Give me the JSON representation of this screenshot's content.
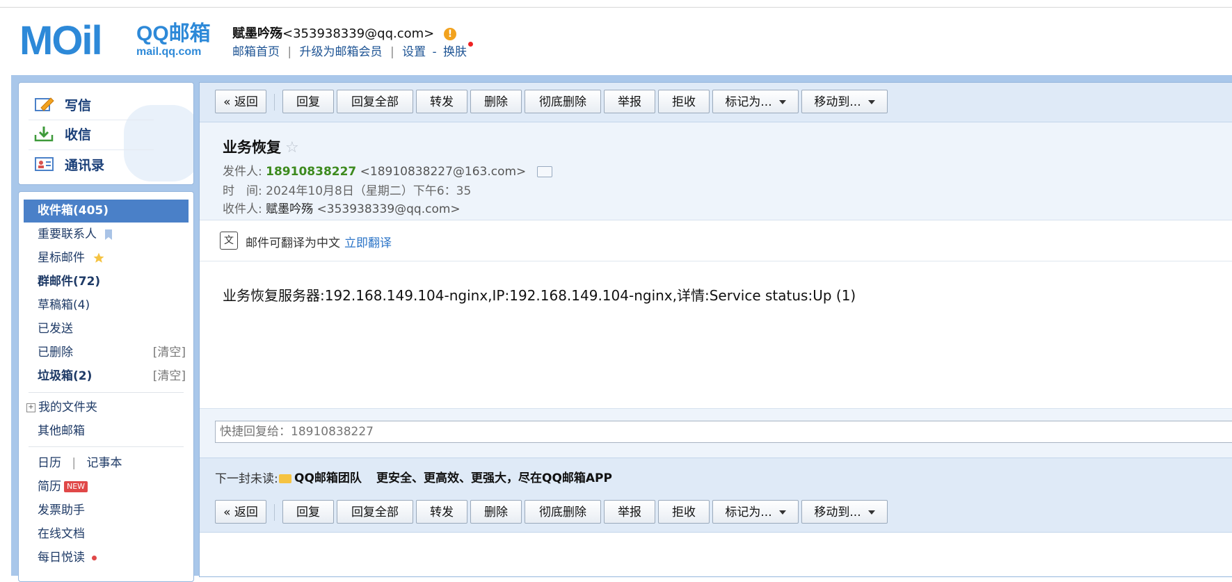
{
  "header": {
    "logo_dom": "mail.qq.com",
    "logo_qq": "QQ邮箱",
    "logo_mark": "MOil",
    "user_name": "赋墨吟殇",
    "user_email": "<353938339@qq.com>",
    "links": [
      "邮箱首页",
      "升级为邮箱会员",
      "设置",
      "换肤"
    ],
    "sep_bar": "|",
    "sep_dash": "-"
  },
  "quick": {
    "compose": "写信",
    "receive": "收信",
    "contacts": "通讯录"
  },
  "folders": {
    "inbox": "收件箱(405)",
    "vip": "重要联系人",
    "starred": "星标邮件",
    "groups": "群邮件(72)",
    "drafts": "草稿箱(4)",
    "sent": "已发送",
    "deleted": "已删除",
    "junk": "垃圾箱(2)",
    "clear": "[清空]",
    "my_folders": "我的文件夹",
    "other_mail": "其他邮箱",
    "calendar": "日历",
    "notes": "记事本",
    "sep": "|",
    "resume": "简历",
    "new_badge": "NEW",
    "invoice": "发票助手",
    "docs": "在线文档",
    "daily": "每日悦读"
  },
  "toolbar": {
    "back": "« 返回",
    "reply": "回复",
    "reply_all": "回复全部",
    "forward": "转发",
    "delete": "删除",
    "delete_perm": "彻底删除",
    "report": "举报",
    "reject": "拒收",
    "mark_as": "标记为...",
    "move_to": "移动到..."
  },
  "mail": {
    "subject": "业务恢复",
    "star": "☆",
    "from_label": "发件人:",
    "from_name": "18910838227",
    "from_addr": "<18910838227@163.com>",
    "time_label": "时　间:",
    "time_value": "2024年10月8日（星期二）下午6：35",
    "to_label": "收件人:",
    "to_name": "赋墨吟殇",
    "to_addr": "<353938339@qq.com>",
    "translate_text": "邮件可翻译为中文",
    "translate_link": "立即翻译",
    "body": "业务恢复服务器:192.168.149.104-nginx,IP:192.168.149.104-nginx,详情:Service status:Up (1)"
  },
  "reply": {
    "placeholder": "快捷回复给：18910838227"
  },
  "next": {
    "label": "下一封未读:",
    "from": "QQ邮箱团队",
    "subject": "更安全、更高效、更强大，尽在QQ邮箱APP"
  }
}
